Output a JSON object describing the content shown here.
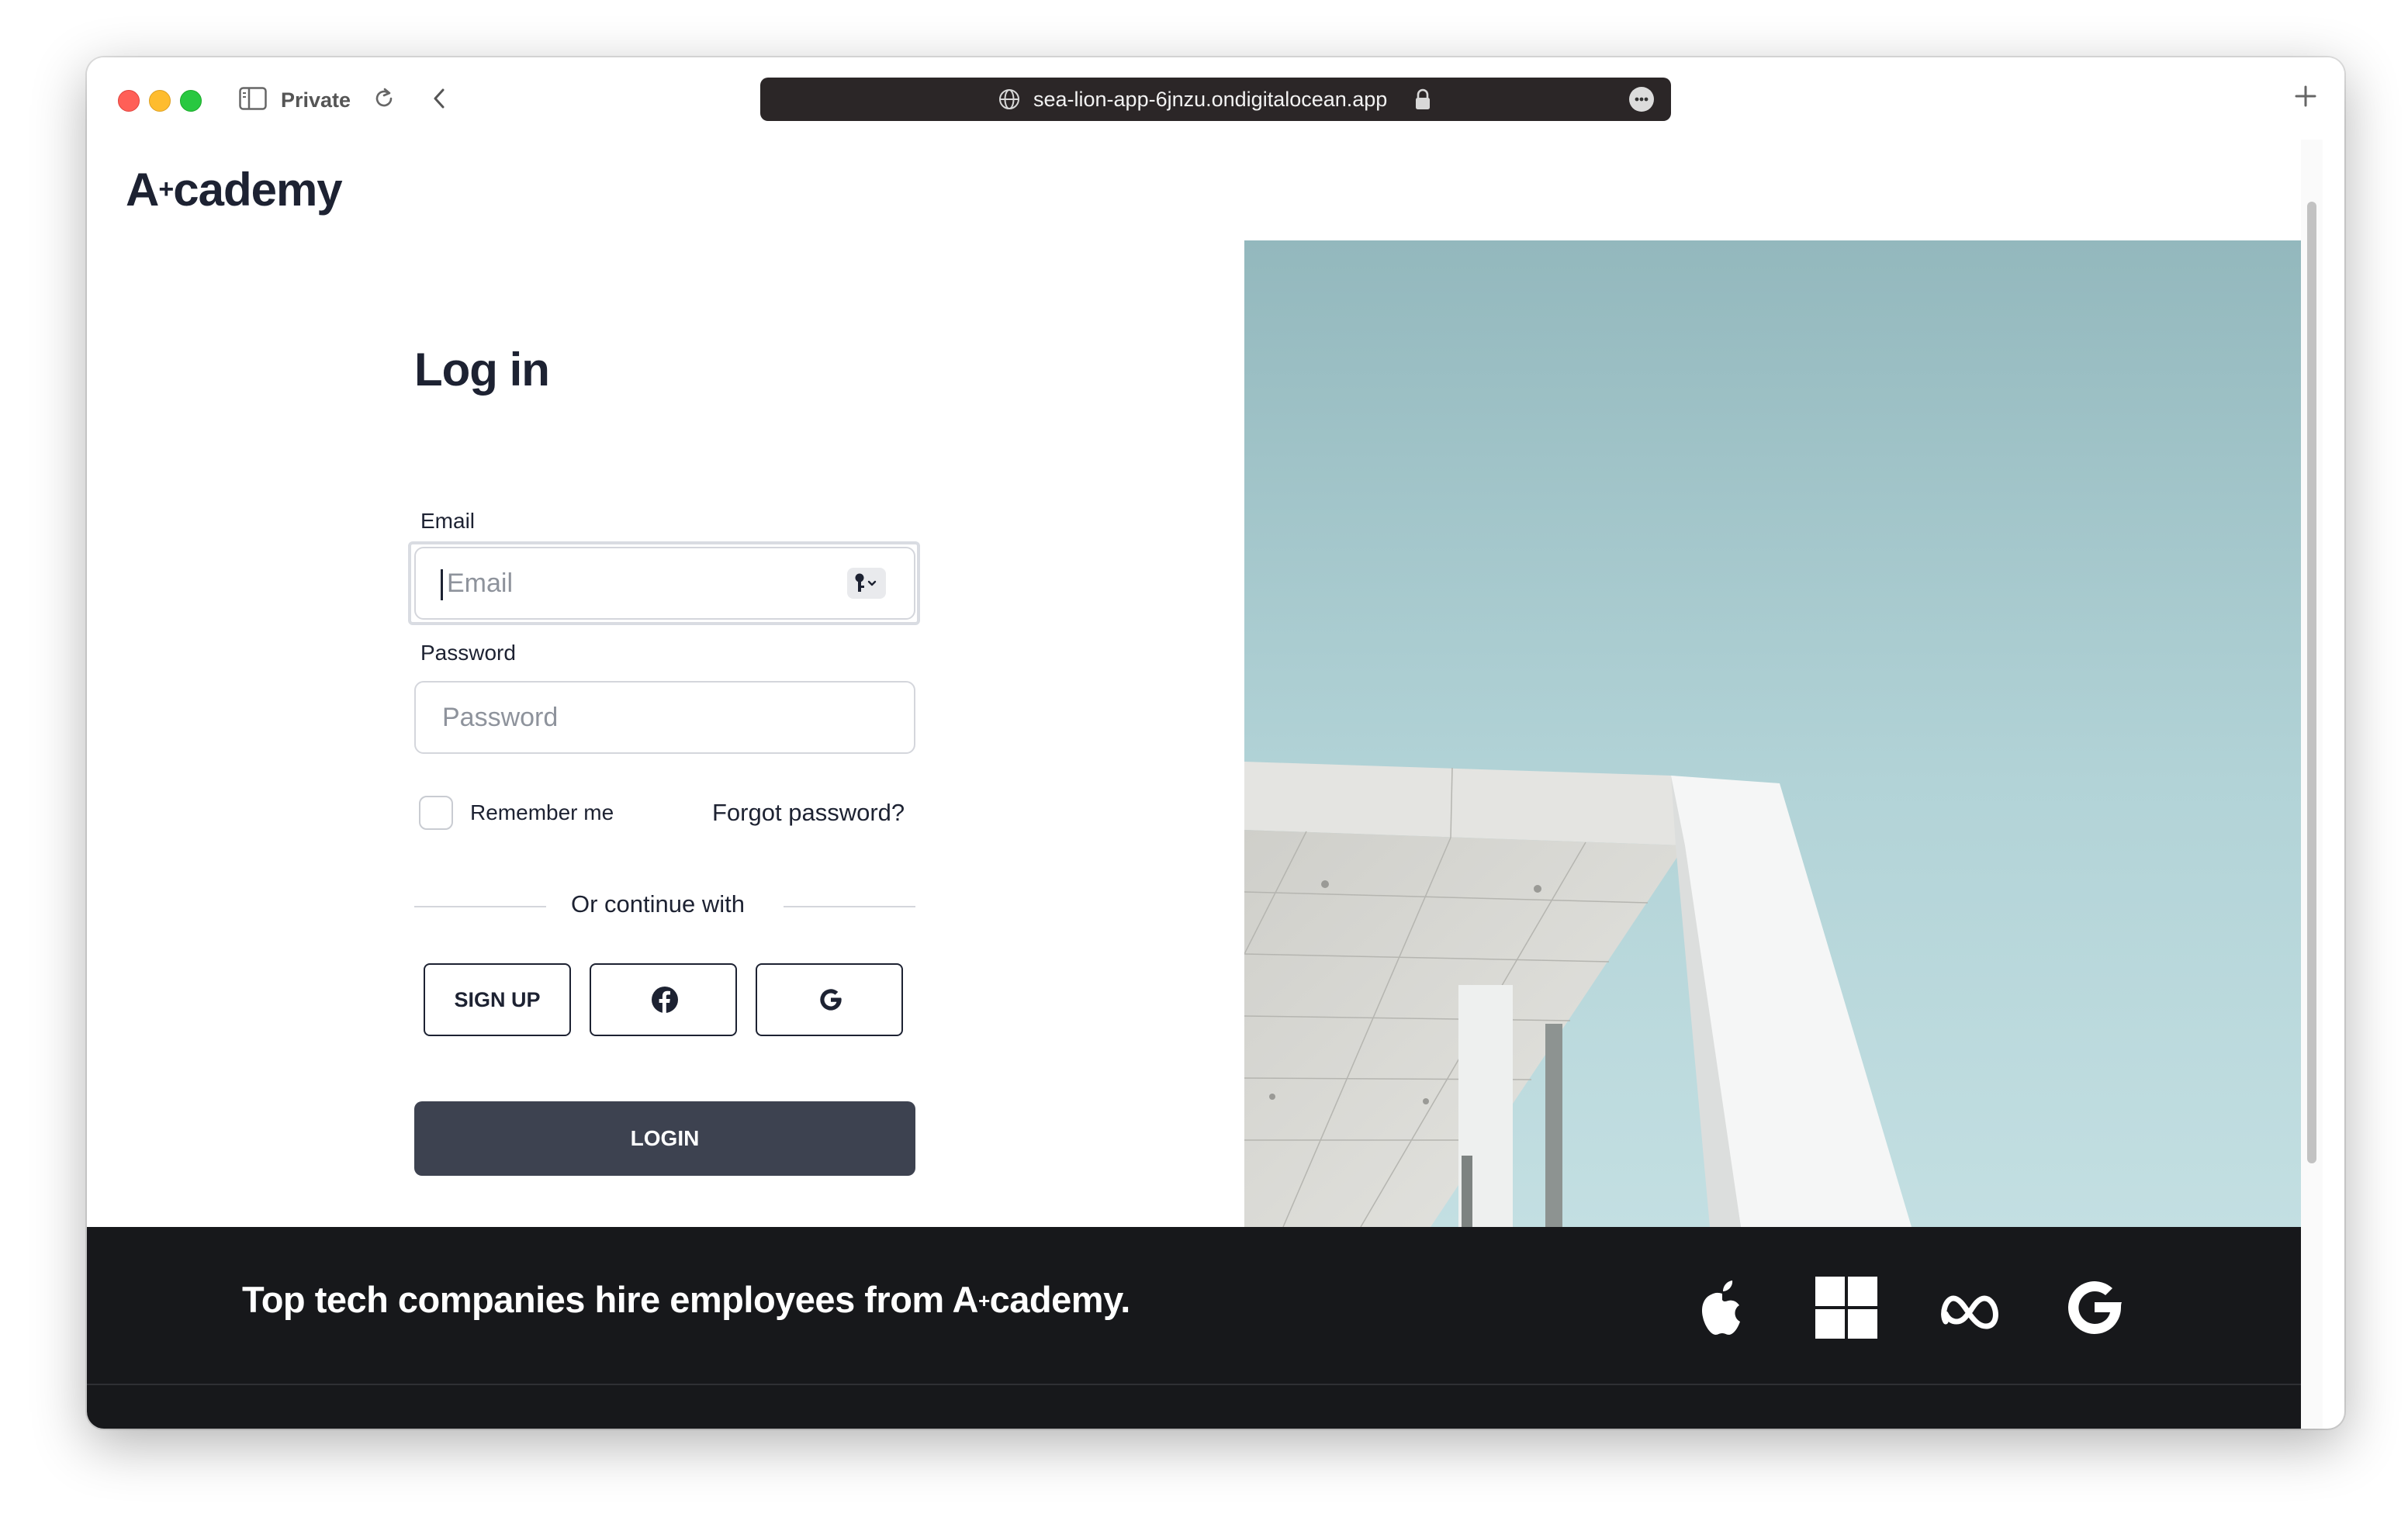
{
  "browser": {
    "private_label": "Private",
    "url": "sea-lion-app-6jnzu.ondigitalocean.app"
  },
  "site": {
    "logo": "A",
    "logo_sup": "+",
    "logo_rest": "cademy"
  },
  "login": {
    "title": "Log in",
    "email_label": "Email",
    "email_placeholder": "Email",
    "password_label": "Password",
    "password_placeholder": "Password",
    "remember_label": "Remember me",
    "remember_checked": false,
    "forgot_label": "Forgot password?",
    "divider_text": "Or continue with",
    "signup_label": "SIGN UP",
    "facebook_icon": "facebook-icon",
    "google_icon": "google-icon",
    "login_label": "LOGIN"
  },
  "footer": {
    "tagline_pre": "Top tech companies hire employees from A",
    "tagline_sup": "+",
    "tagline_post": "cademy.",
    "companies": [
      "apple-logo",
      "windows-logo",
      "meta-logo",
      "google-logo"
    ]
  },
  "colors": {
    "primary_button": "#3d4250",
    "text": "#1d2232",
    "footer_bg": "#17181b",
    "sky": "#a9cfd4"
  }
}
